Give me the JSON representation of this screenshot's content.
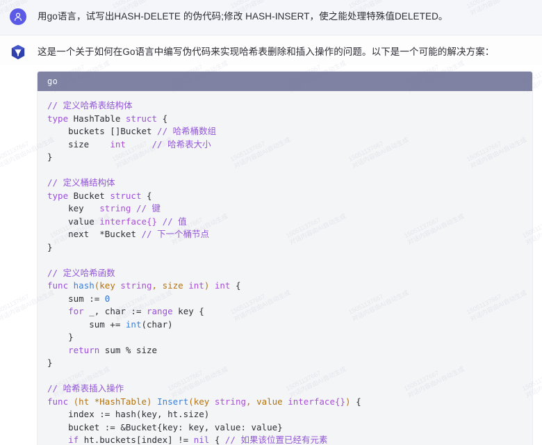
{
  "conversation": {
    "messages": [
      {
        "role": "user",
        "avatar_icon": "user-person-icon",
        "avatar_color": "#5a5ae6",
        "text": "用go语言，试写出HASH-DELETE 的伪代码;修改 HASH-INSERT，使之能处理特殊值DELETED。"
      },
      {
        "role": "assistant",
        "avatar_icon": "ai-assistant-logo-icon",
        "avatar_color": "#3b4ab8",
        "text": "这是一个关于如何在Go语言中编写伪代码来实现哈希表删除和插入操作的问题。以下是一个可能的解决方案："
      }
    ]
  },
  "code_block": {
    "language_label": "go",
    "header_bg": "#7f82a3",
    "body_bg": "#f4f5f7",
    "copy_label": "",
    "lines": [
      {
        "id": 1,
        "tokens": [
          {
            "c": "t-cmt",
            "t": "// 定义哈希表结构体"
          }
        ]
      },
      {
        "id": 2,
        "tokens": [
          {
            "c": "t-kw",
            "t": "type"
          },
          {
            "c": "t-pln",
            "t": " HashTable "
          },
          {
            "c": "t-kw",
            "t": "struct"
          },
          {
            "c": "t-pln",
            "t": " {"
          }
        ]
      },
      {
        "id": 3,
        "tokens": [
          {
            "c": "t-pln",
            "t": "    buckets []Bucket "
          },
          {
            "c": "t-cmt",
            "t": "// 哈希桶数组"
          }
        ]
      },
      {
        "id": 4,
        "tokens": [
          {
            "c": "t-pln",
            "t": "    size    "
          },
          {
            "c": "t-typ",
            "t": "int"
          },
          {
            "c": "t-pln",
            "t": "     "
          },
          {
            "c": "t-cmt",
            "t": "// 哈希表大小"
          }
        ]
      },
      {
        "id": 5,
        "tokens": [
          {
            "c": "t-pln",
            "t": "}"
          }
        ]
      },
      {
        "id": 6,
        "tokens": []
      },
      {
        "id": 7,
        "tokens": [
          {
            "c": "t-cmt",
            "t": "// 定义桶结构体"
          }
        ]
      },
      {
        "id": 8,
        "tokens": [
          {
            "c": "t-kw",
            "t": "type"
          },
          {
            "c": "t-pln",
            "t": " Bucket "
          },
          {
            "c": "t-kw",
            "t": "struct"
          },
          {
            "c": "t-pln",
            "t": " {"
          }
        ]
      },
      {
        "id": 9,
        "tokens": [
          {
            "c": "t-pln",
            "t": "    key   "
          },
          {
            "c": "t-typ",
            "t": "string"
          },
          {
            "c": "t-pln",
            "t": " "
          },
          {
            "c": "t-cmt",
            "t": "// 键"
          }
        ]
      },
      {
        "id": 10,
        "tokens": [
          {
            "c": "t-pln",
            "t": "    value "
          },
          {
            "c": "t-typ",
            "t": "interface{}"
          },
          {
            "c": "t-pln",
            "t": " "
          },
          {
            "c": "t-cmt",
            "t": "// 值"
          }
        ]
      },
      {
        "id": 11,
        "tokens": [
          {
            "c": "t-pln",
            "t": "    next  *Bucket "
          },
          {
            "c": "t-cmt",
            "t": "// 下一个桶节点"
          }
        ]
      },
      {
        "id": 12,
        "tokens": [
          {
            "c": "t-pln",
            "t": "}"
          }
        ]
      },
      {
        "id": 13,
        "tokens": []
      },
      {
        "id": 14,
        "tokens": [
          {
            "c": "t-cmt",
            "t": "// 定义哈希函数"
          }
        ]
      },
      {
        "id": 15,
        "tokens": [
          {
            "c": "t-kw",
            "t": "func"
          },
          {
            "c": "t-pln",
            "t": " "
          },
          {
            "c": "t-fn",
            "t": "hash"
          },
          {
            "c": "t-par",
            "t": "(key "
          },
          {
            "c": "t-typ",
            "t": "string"
          },
          {
            "c": "t-par",
            "t": ", size "
          },
          {
            "c": "t-typ",
            "t": "int"
          },
          {
            "c": "t-par",
            "t": ")"
          },
          {
            "c": "t-pln",
            "t": " "
          },
          {
            "c": "t-typ",
            "t": "int"
          },
          {
            "c": "t-pln",
            "t": " {"
          }
        ]
      },
      {
        "id": 16,
        "tokens": [
          {
            "c": "t-pln",
            "t": "    sum := "
          },
          {
            "c": "t-num",
            "t": "0"
          }
        ]
      },
      {
        "id": 17,
        "tokens": [
          {
            "c": "t-pln",
            "t": "    "
          },
          {
            "c": "t-kw",
            "t": "for"
          },
          {
            "c": "t-pln",
            "t": " _, char := "
          },
          {
            "c": "t-kw",
            "t": "range"
          },
          {
            "c": "t-pln",
            "t": " key {"
          }
        ]
      },
      {
        "id": 18,
        "tokens": [
          {
            "c": "t-pln",
            "t": "        sum += "
          },
          {
            "c": "t-fn",
            "t": "int"
          },
          {
            "c": "t-pln",
            "t": "(char)"
          }
        ]
      },
      {
        "id": 19,
        "tokens": [
          {
            "c": "t-pln",
            "t": "    }"
          }
        ]
      },
      {
        "id": 20,
        "tokens": [
          {
            "c": "t-pln",
            "t": "    "
          },
          {
            "c": "t-kw",
            "t": "return"
          },
          {
            "c": "t-pln",
            "t": " sum % size"
          }
        ]
      },
      {
        "id": 21,
        "tokens": [
          {
            "c": "t-pln",
            "t": "}"
          }
        ]
      },
      {
        "id": 22,
        "tokens": []
      },
      {
        "id": 23,
        "tokens": [
          {
            "c": "t-cmt",
            "t": "// 哈希表插入操作"
          }
        ]
      },
      {
        "id": 24,
        "tokens": [
          {
            "c": "t-kw",
            "t": "func"
          },
          {
            "c": "t-pln",
            "t": " "
          },
          {
            "c": "t-par",
            "t": "(ht *HashTable)"
          },
          {
            "c": "t-pln",
            "t": " "
          },
          {
            "c": "t-fn",
            "t": "Insert"
          },
          {
            "c": "t-par",
            "t": "(key "
          },
          {
            "c": "t-typ",
            "t": "string"
          },
          {
            "c": "t-par",
            "t": ", value "
          },
          {
            "c": "t-typ",
            "t": "interface{}"
          },
          {
            "c": "t-par",
            "t": ")"
          },
          {
            "c": "t-pln",
            "t": " {"
          }
        ]
      },
      {
        "id": 25,
        "tokens": [
          {
            "c": "t-pln",
            "t": "    index := hash(key, ht.size)"
          }
        ]
      },
      {
        "id": 26,
        "tokens": [
          {
            "c": "t-pln",
            "t": "    bucket := &Bucket{key: key, value: value}"
          }
        ]
      },
      {
        "id": 27,
        "tokens": [
          {
            "c": "t-pln",
            "t": "    "
          },
          {
            "c": "t-kw",
            "t": "if"
          },
          {
            "c": "t-pln",
            "t": " ht.buckets[index] != "
          },
          {
            "c": "t-nil",
            "t": "nil"
          },
          {
            "c": "t-pln",
            "t": " { "
          },
          {
            "c": "t-cmt",
            "t": "// 如果该位置已经有元素"
          }
        ]
      }
    ]
  },
  "watermark": {
    "line1": "15051137667",
    "line2": "对话内容由AI自动生成"
  }
}
